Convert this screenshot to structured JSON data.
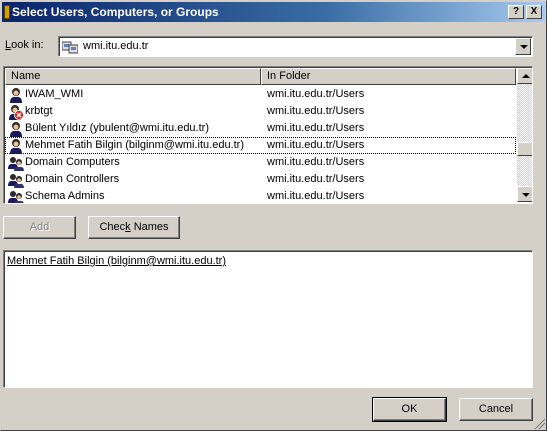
{
  "dialog": {
    "title": "Select Users, Computers, or Groups",
    "help_button": "?",
    "close_button": "X"
  },
  "look_in": {
    "label_accel": "L",
    "label_rest": "ook in:",
    "value": "wmi.itu.edu.tr",
    "icon": "domain-folder-icon"
  },
  "list": {
    "columns": [
      "Name",
      "In Folder"
    ],
    "rows": [
      {
        "name": "IWAM_WMI",
        "folder": "wmi.itu.edu.tr/Users",
        "icon": "user-icon"
      },
      {
        "name": "krbtgt",
        "folder": "wmi.itu.edu.tr/Users",
        "icon": "disabled-user-icon"
      },
      {
        "name": "Bülent Yıldız (ybulent@wmi.itu.edu.tr)",
        "folder": "wmi.itu.edu.tr/Users",
        "icon": "user-icon"
      },
      {
        "name": "Mehmet Fatih Bilgin (bilginm@wmi.itu.edu.tr)",
        "folder": "wmi.itu.edu.tr/Users",
        "icon": "user-icon",
        "focused": true
      },
      {
        "name": "Domain Computers",
        "folder": "wmi.itu.edu.tr/Users",
        "icon": "group-icon"
      },
      {
        "name": "Domain Controllers",
        "folder": "wmi.itu.edu.tr/Users",
        "icon": "group-icon"
      },
      {
        "name": "Schema Admins",
        "folder": "wmi.itu.edu.tr/Users",
        "icon": "group-icon"
      }
    ]
  },
  "buttons": {
    "add": "Add",
    "check_names_accel": "k",
    "check_names_pre": "Chec",
    "check_names_post": " Names",
    "ok": "OK",
    "cancel": "Cancel"
  },
  "selected": {
    "entry": "Mehmet Fatih Bilgin (bilginm@wmi.itu.edu.tr)"
  }
}
